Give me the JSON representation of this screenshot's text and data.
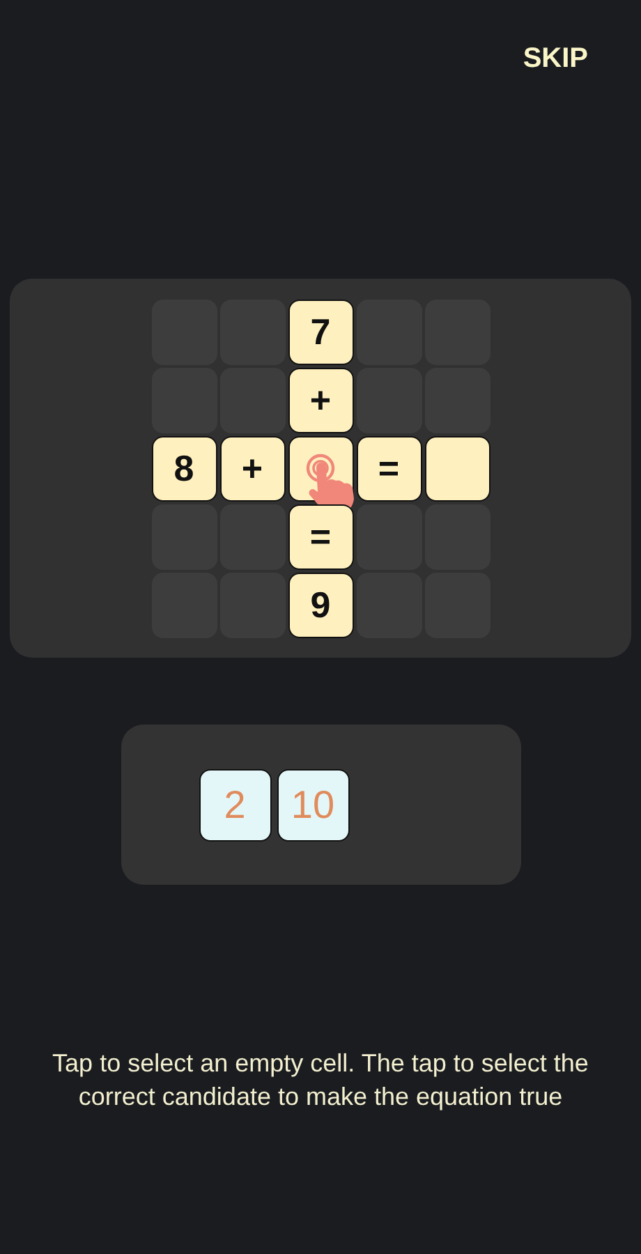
{
  "skip_button": {
    "label": "SKIP"
  },
  "board": {
    "rows": [
      [
        {
          "kind": "blank"
        },
        {
          "kind": "blank"
        },
        {
          "kind": "tile",
          "value": "7"
        },
        {
          "kind": "blank"
        },
        {
          "kind": "blank"
        }
      ],
      [
        {
          "kind": "blank"
        },
        {
          "kind": "blank"
        },
        {
          "kind": "tile",
          "value": "+"
        },
        {
          "kind": "blank"
        },
        {
          "kind": "blank"
        }
      ],
      [
        {
          "kind": "tile",
          "value": "8"
        },
        {
          "kind": "tile",
          "value": "+"
        },
        {
          "kind": "tile",
          "hint": true
        },
        {
          "kind": "tile",
          "value": "="
        },
        {
          "kind": "tile"
        }
      ],
      [
        {
          "kind": "blank"
        },
        {
          "kind": "blank"
        },
        {
          "kind": "tile",
          "value": "="
        },
        {
          "kind": "blank"
        },
        {
          "kind": "blank"
        }
      ],
      [
        {
          "kind": "blank"
        },
        {
          "kind": "blank"
        },
        {
          "kind": "tile",
          "value": "9"
        },
        {
          "kind": "blank"
        },
        {
          "kind": "blank"
        }
      ]
    ]
  },
  "candidates": [
    "2",
    "10"
  ],
  "instructions": "Tap to select an empty cell. The tap to select the correct candidate to make the equation true"
}
